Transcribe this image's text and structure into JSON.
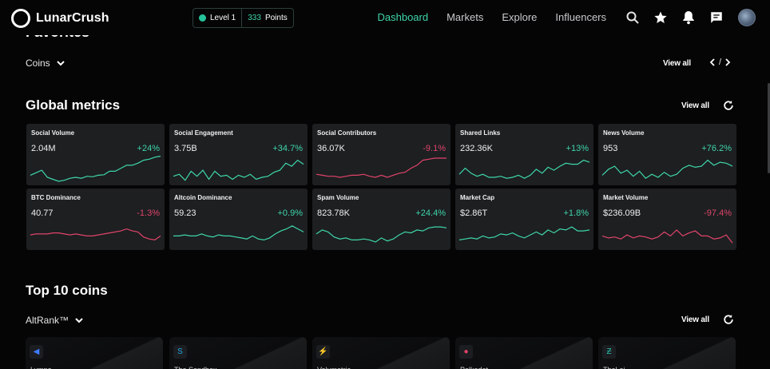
{
  "brand": {
    "name": "LunarCrush"
  },
  "level_pill": {
    "level": "Level 1",
    "points_value": "333",
    "points_label": "Points"
  },
  "nav": {
    "links": [
      "Dashboard",
      "Markets",
      "Explore",
      "Influencers"
    ],
    "active": "Dashboard",
    "icons": [
      "search-icon",
      "star-icon",
      "bell-icon",
      "chat-icon",
      "avatar"
    ]
  },
  "favorites": {
    "title": "Favorites",
    "filter": "Coins",
    "view_all": "View all",
    "pager_sep": "/"
  },
  "global_metrics": {
    "title": "Global metrics",
    "view_all": "View all",
    "cards": [
      {
        "title": "Social Volume",
        "value": "2.04M",
        "change": "+24%",
        "trend": "up",
        "spark": [
          60,
          55,
          50,
          64,
          68,
          72,
          70,
          66,
          64,
          66,
          62,
          63,
          60,
          59,
          52,
          52,
          46,
          40,
          40,
          36,
          30,
          28,
          24,
          22
        ]
      },
      {
        "title": "Social Engagement",
        "value": "3.75B",
        "change": "+34.7%",
        "trend": "up",
        "spark": [
          62,
          58,
          70,
          52,
          62,
          50,
          68,
          52,
          62,
          60,
          68,
          60,
          64,
          58,
          68,
          64,
          62,
          54,
          50,
          36,
          42,
          30,
          38
        ]
      },
      {
        "title": "Social Contributors",
        "value": "36.07K",
        "change": "-9.1%",
        "trend": "down",
        "spark": [
          58,
          60,
          62,
          62,
          64,
          62,
          60,
          60,
          58,
          62,
          64,
          60,
          64,
          60,
          56,
          54,
          46,
          40,
          30,
          28,
          26,
          26,
          26
        ]
      },
      {
        "title": "Shared Links",
        "value": "232.36K",
        "change": "+13%",
        "trend": "up",
        "spark": [
          58,
          46,
          56,
          62,
          58,
          64,
          64,
          62,
          66,
          64,
          60,
          66,
          60,
          48,
          56,
          44,
          50,
          42,
          36,
          38,
          38,
          30,
          34
        ]
      },
      {
        "title": "News Volume",
        "value": "953",
        "change": "+76.2%",
        "trend": "up",
        "spark": [
          60,
          48,
          42,
          56,
          50,
          62,
          52,
          66,
          58,
          64,
          54,
          62,
          58,
          46,
          40,
          44,
          42,
          30,
          40,
          34,
          36,
          42
        ]
      },
      {
        "title": "BTC Dominance",
        "value": "40.77",
        "change": "-1.3%",
        "trend": "down",
        "spark": [
          50,
          48,
          48,
          48,
          46,
          46,
          48,
          50,
          48,
          50,
          52,
          52,
          50,
          48,
          46,
          44,
          42,
          38,
          42,
          44,
          54,
          58,
          60,
          52
        ]
      },
      {
        "title": "Altcoin Dominance",
        "value": "59.23",
        "change": "+0.9%",
        "trend": "up",
        "spark": [
          52,
          52,
          50,
          52,
          52,
          48,
          52,
          54,
          50,
          52,
          52,
          54,
          56,
          58,
          52,
          58,
          60,
          56,
          48,
          42,
          38,
          32,
          38,
          44
        ]
      },
      {
        "title": "Spam Volume",
        "value": "823.78K",
        "change": "+24.4%",
        "trend": "up",
        "spark": [
          48,
          40,
          44,
          54,
          58,
          56,
          60,
          60,
          58,
          60,
          64,
          56,
          62,
          58,
          50,
          44,
          46,
          40,
          42,
          36,
          34,
          34,
          36
        ]
      },
      {
        "title": "Market Cap",
        "value": "$2.86T",
        "change": "+1.8%",
        "trend": "up",
        "spark": [
          60,
          58,
          56,
          58,
          52,
          56,
          54,
          48,
          50,
          46,
          52,
          56,
          50,
          44,
          50,
          40,
          46,
          38,
          40,
          34,
          42,
          42,
          40
        ]
      },
      {
        "title": "Market Volume",
        "value": "$236.09B",
        "change": "-97.4%",
        "trend": "down",
        "spark": [
          52,
          56,
          54,
          58,
          50,
          56,
          52,
          54,
          58,
          54,
          44,
          52,
          40,
          52,
          46,
          42,
          52,
          52,
          58,
          56,
          50,
          66
        ]
      }
    ]
  },
  "top_coins": {
    "title": "Top 10 coins",
    "filter": "AltRank™",
    "view_all": "View all",
    "coins": [
      {
        "name": "Lympo",
        "icon": "lympo-icon",
        "glyph": "◀"
      },
      {
        "name": "The Sandbox",
        "icon": "sandbox-icon",
        "glyph": "S"
      },
      {
        "name": "Volumetric",
        "icon": "volumetric-icon",
        "glyph": "⚡"
      },
      {
        "name": "Polkadot",
        "icon": "polkadot-icon",
        "glyph": "●"
      },
      {
        "name": "TheLoi",
        "icon": "theloi-icon",
        "glyph": "Ƶ"
      }
    ]
  },
  "colors": {
    "accent": "#3fd6a8",
    "negative": "#e0446a",
    "card_bg": "#1d1f21",
    "page_bg": "#050506"
  }
}
